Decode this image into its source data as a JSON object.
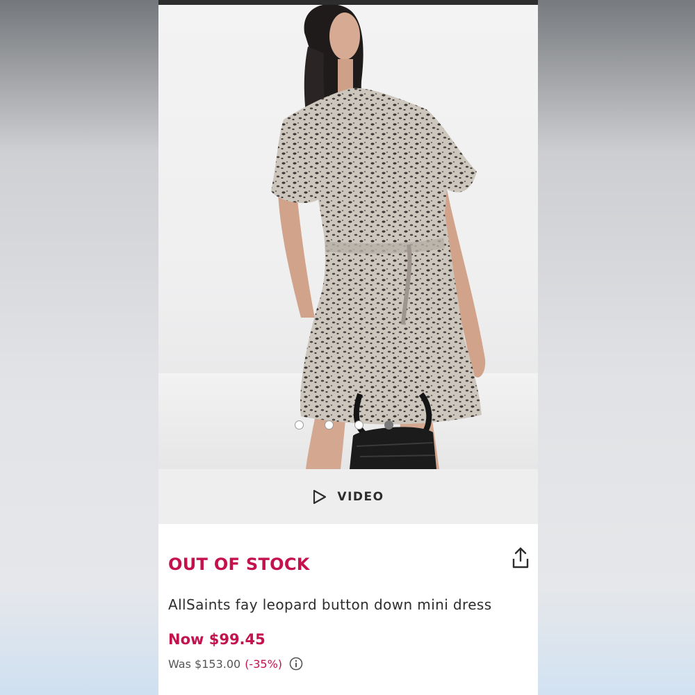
{
  "product": {
    "stock_status": "OUT OF STOCK",
    "title": "AllSaints fay leopard button down mini dress",
    "price_now": "Now $99.45",
    "price_was": "Was $153.00",
    "discount": "(-35%)"
  },
  "gallery": {
    "image_count": 4,
    "active_index": 3
  },
  "video": {
    "label": "VIDEO"
  },
  "icons": {
    "play": "play-icon",
    "share": "share-icon",
    "info": "info-icon"
  },
  "colors": {
    "accent": "#c4124d",
    "text": "#2d2d2d",
    "muted": "#555555",
    "video_bar_bg": "#eeeeee"
  }
}
